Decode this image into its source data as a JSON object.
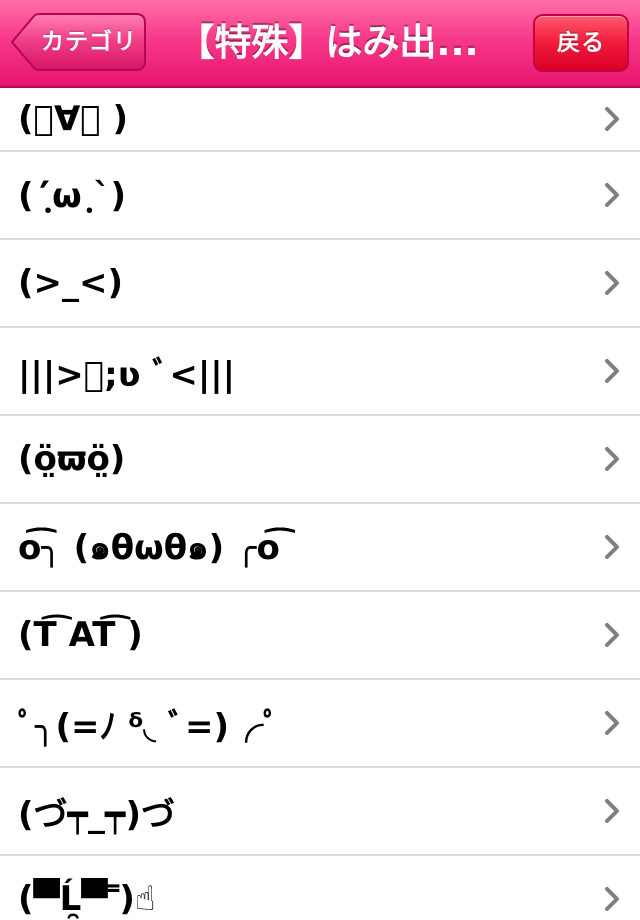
{
  "navbar": {
    "back_label": "カテゴリ",
    "title": "【特殊】はみ出...",
    "right_label": "戻る",
    "colors": {
      "bar": "#f7398a",
      "right_button": "#f21a3a"
    }
  },
  "list": {
    "items": [
      {
        "text": "(ﾟ∀ﾟ )"
      },
      {
        "text": "(´ฺω ฺ`)"
      },
      {
        "text": "(>_<)"
      },
      {
        "text": "|||>ﾞ;ʋ ﾞ<|||"
      },
      {
        "text": "(ö̤ϖö̤)"
      },
      {
        "text": "o͡͡͡╮ (๑θωθ๑) ╭o͡͡͡"
      },
      {
        "text": "(T͡ AT͡ )"
      },
      {
        "text": "ﾟ╮(=ﾉ ᵟ◟ ﾞ=)╭ﾟ"
      },
      {
        "text": "(づ┯_┯)づ"
      },
      {
        "text": "(▀̿Ĺ̯▀̿ ̿)☝"
      }
    ],
    "chevron_icon": "chevron-right-icon"
  }
}
